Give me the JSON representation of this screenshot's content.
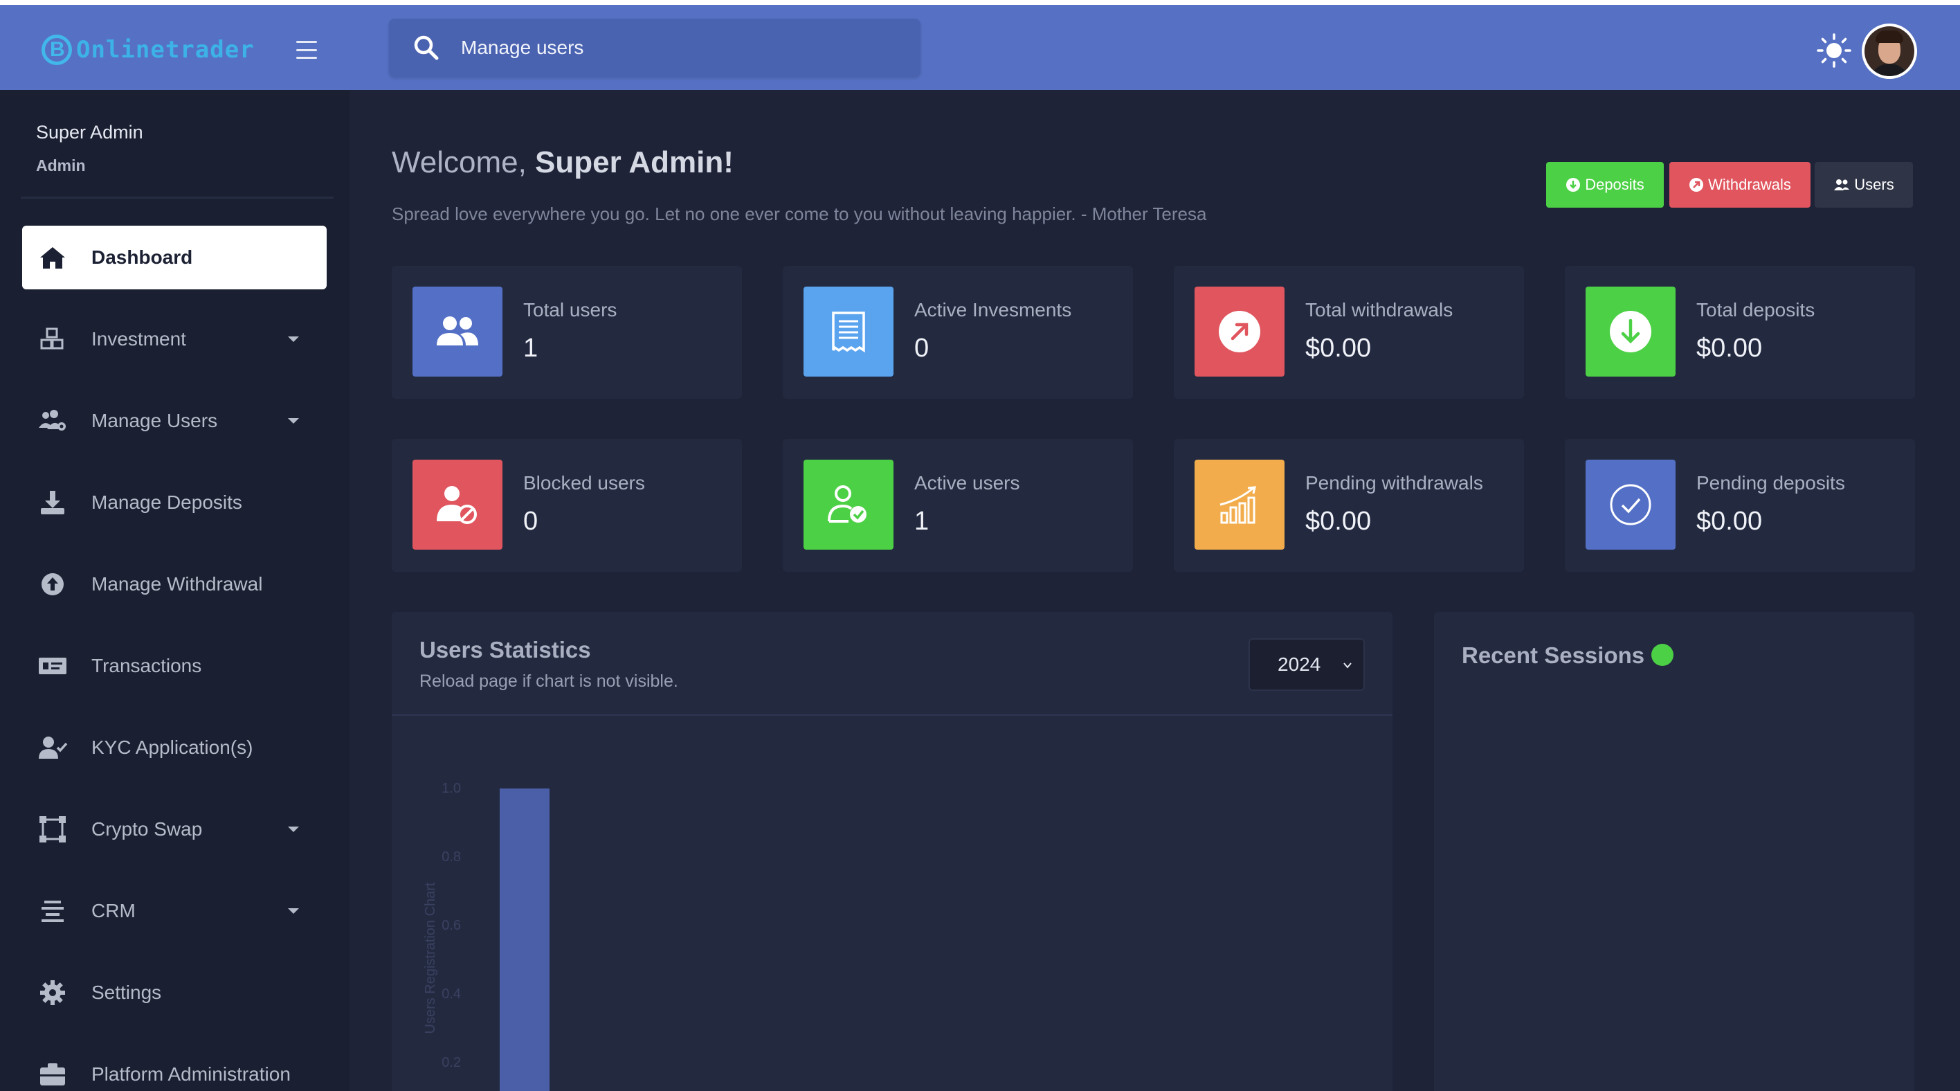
{
  "header": {
    "logo_text": "Onlinetrader",
    "search_text": "Manage users"
  },
  "sidebar": {
    "user_name": "Super Admin",
    "user_role": "Admin",
    "items": [
      {
        "label": "Dashboard",
        "icon": "home-icon",
        "active": true,
        "caret": false
      },
      {
        "label": "Investment",
        "icon": "cubes-icon",
        "active": false,
        "caret": true
      },
      {
        "label": "Manage Users",
        "icon": "users-cog-icon",
        "active": false,
        "caret": true
      },
      {
        "label": "Manage Deposits",
        "icon": "download-icon",
        "active": false,
        "caret": false
      },
      {
        "label": "Manage Withdrawal",
        "icon": "arrow-circle-up-icon",
        "active": false,
        "caret": false
      },
      {
        "label": "Transactions",
        "icon": "money-check-icon",
        "active": false,
        "caret": false
      },
      {
        "label": "KYC Application(s)",
        "icon": "user-check-icon",
        "active": false,
        "caret": false
      },
      {
        "label": "Crypto Swap",
        "icon": "vector-square-icon",
        "active": false,
        "caret": true
      },
      {
        "label": "CRM",
        "icon": "align-center-icon",
        "active": false,
        "caret": true
      },
      {
        "label": "Settings",
        "icon": "gear-icon",
        "active": false,
        "caret": false
      },
      {
        "label": "Platform Administration",
        "icon": "briefcase-icon",
        "active": false,
        "caret": false
      }
    ]
  },
  "main": {
    "welcome_prefix": "Welcome, ",
    "welcome_name": "Super Admin!",
    "quote": "Spread love everywhere you go. Let no one ever come to you without leaving happier. - Mother Teresa",
    "buttons": {
      "deposits": "Deposits",
      "withdrawals": "Withdrawals",
      "users": "Users"
    },
    "cards": [
      {
        "label": "Total users",
        "value": "1",
        "color": "#5470c6",
        "icon": "users-icon"
      },
      {
        "label": "Active Invesments",
        "value": "0",
        "color": "#5aa3ee",
        "icon": "receipt-icon"
      },
      {
        "label": "Total withdrawals",
        "value": "$0.00",
        "color": "#e0555e",
        "icon": "arrow-up-right-circle-icon"
      },
      {
        "label": "Total deposits",
        "value": "$0.00",
        "color": "#4cd045",
        "icon": "arrow-down-circle-icon"
      },
      {
        "label": "Blocked users",
        "value": "0",
        "color": "#e0555e",
        "icon": "user-blocked-icon"
      },
      {
        "label": "Active users",
        "value": "1",
        "color": "#4cd045",
        "icon": "user-check-icon"
      },
      {
        "label": "Pending withdrawals",
        "value": "$0.00",
        "color": "#f2ac4b",
        "icon": "growth-chart-icon"
      },
      {
        "label": "Pending deposits",
        "value": "$0.00",
        "color": "#5470c6",
        "icon": "check-circle-icon"
      }
    ],
    "stats": {
      "title": "Users Statistics",
      "subtitle": "Reload page if chart is not visible.",
      "year": "2024"
    },
    "sessions": {
      "title": "Recent Sessions"
    }
  },
  "chart_data": {
    "type": "bar",
    "ylabel": "Users Registration Chart",
    "yticks": [
      "1.0",
      "0.8",
      "0.6",
      "0.4",
      "0.2"
    ],
    "ylim": [
      0,
      1.0
    ],
    "values": [
      1
    ],
    "bar_color": "#4a5fa8"
  }
}
